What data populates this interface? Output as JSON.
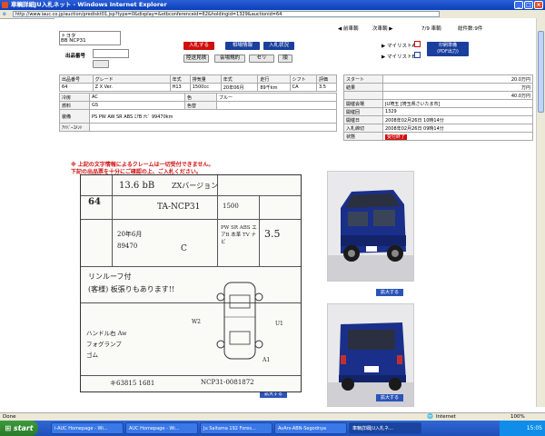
{
  "window": {
    "title": "車輌詳細JU入札ネット - Windows Internet Explorer",
    "url": "http://www.iauc.co.jp/auction/prediskt01.jsp?type=0&display=&otbconferenceid=62&holdingid=1329&auctionid=64"
  },
  "nav": {
    "prev": "前車輌",
    "next": "次車輌",
    "position": "7/9 車輌",
    "total": "総件数:9件"
  },
  "header": {
    "maker": "トヨタ",
    "model": "BB NCP31",
    "lot_label": "出品番号",
    "search_button": "検索"
  },
  "buttons": {
    "bid": "入札する",
    "market": "相場情報",
    "bid_status": "入札状況",
    "auction_sheet": "陸送見積",
    "venue": "会場規約",
    "seri": "セリ",
    "back": "順",
    "print": "印刷準備\n(PDF出力)",
    "mylist_a": "マイリストA",
    "mylist_b": "マイリストB",
    "zoom1": "拡大する",
    "zoom2": "拡大する",
    "zoom3": "拡大する"
  },
  "spec_table": {
    "headers": [
      "出品番号",
      "グレード",
      "年式",
      "排気量",
      "年式",
      "走行",
      "シフト",
      "評価"
    ],
    "values": [
      "64",
      "Z X Ver.",
      "H13",
      "1500cc",
      "20年06月",
      "89千km",
      "CA",
      "3.5"
    ]
  },
  "detail_table": [
    [
      "冷房",
      "AC",
      "色",
      "ブルー"
    ],
    [
      "燃料",
      "GS",
      "色替",
      ""
    ],
    [
      "装備",
      "PS PW AW SR ABS ｴｱB ﾅﾋﾞ 99470km",
      "",
      ""
    ],
    [
      "ｱｲﾊﾞｰｺﾒﾝﾄ",
      "",
      "",
      ""
    ]
  ],
  "price_table": [
    [
      "スタート",
      "20.0万円"
    ],
    [
      "結果",
      "万円"
    ],
    [
      "",
      "40.0万円"
    ],
    [
      "開催会場",
      "JU埼玉 [埼玉県さいたま市]"
    ],
    [
      "開催回",
      "1329"
    ],
    [
      "開催日",
      "2008年02月26日 10時14分"
    ],
    [
      "入札締切",
      "2008年02月26日 09時14分"
    ],
    [
      "状態",
      "受付終了"
    ]
  ],
  "warning": {
    "line1": "※ 上記の文字情報によるクレームは一切受付できません。",
    "line2": "下記の出品票を十分にご確認の上、ご入札ください。"
  },
  "sheet": {
    "lot": "64",
    "top_text": "13.6 bB",
    "grade_text": "ZXバージョン",
    "model_code": "TA-NCP31",
    "cc": "1500",
    "score": "3.5",
    "year_text": "20年6月",
    "km_text": "89470",
    "note1": "リンルーフ付",
    "note2": "(客様) 板張りもあります!!",
    "options": "PW SR ABS エアB 本革 TV ナビ",
    "color_code": "C",
    "hw_label1": "ハンドル右 Aw",
    "hw_label2": "フォグランプ",
    "hw_label3": "ゴム",
    "chassis": "NCP31-0081872",
    "serial": "キ63815 1681",
    "w2": "W2",
    "u1": "U1",
    "a1": "A1"
  },
  "status": {
    "left": "Done",
    "zone": "Internet",
    "zoom": "100%"
  },
  "taskbar": {
    "start": "start",
    "tasks": [
      "i-AUC Homepage - Wi...",
      "AUC Homepage - Wi...",
      "Ju Saitama 192 Fores...",
      "AvArs-ABN-Segodnya",
      "車輌詳細JU入札ネ..."
    ],
    "time": "15:05"
  },
  "colors": {
    "accent_red": "#d01010",
    "accent_blue": "#1a3f9c",
    "titlebar": "#0a3fb8"
  }
}
